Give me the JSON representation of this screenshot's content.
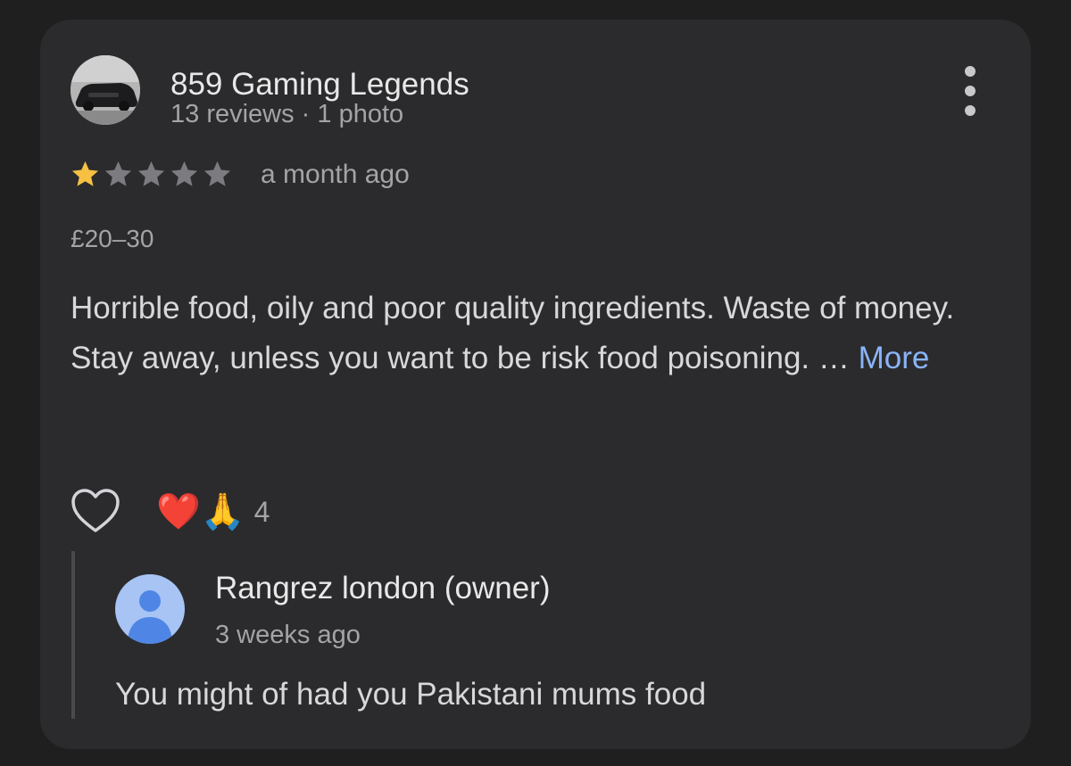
{
  "review": {
    "reviewer_name": "859 Gaming Legends",
    "reviewer_reviews": "13 reviews",
    "meta_separator": " · ",
    "reviewer_photos": "1 photo",
    "rating": 1,
    "rating_max": 5,
    "time_ago": "a month ago",
    "price_range": "£20–30",
    "text": "Horrible food, oily and poor quality ingredients. Waste of money. Stay away, unless you want to be risk food poisoning. … ",
    "more_label": "More",
    "reactions": {
      "emojis": [
        "❤️",
        "🙏"
      ],
      "count": "4"
    },
    "colors": {
      "star_filled": "#f6c043",
      "star_empty": "#7c7c80",
      "link": "#8ab4f8"
    }
  },
  "owner_reply": {
    "name": "Rangrez london (owner)",
    "time_ago": "3 weeks ago",
    "text": "You might of had you Pakistani mums food",
    "avatar_color": "#a8c4f5",
    "avatar_figure_color": "#4f86e6"
  },
  "icons": {
    "menu": "more-vert-icon",
    "like": "heart-outline-icon",
    "owner_avatar": "person-icon"
  }
}
